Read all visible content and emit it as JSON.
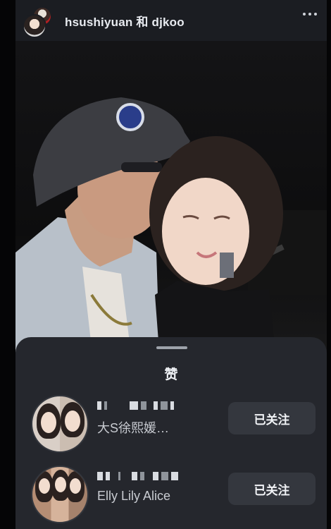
{
  "header": {
    "title": "hsushiyuan 和 djkoo",
    "more_icon": "more-horizontal-icon"
  },
  "photo": {
    "description_icon": "photo-image"
  },
  "likes_sheet": {
    "title": "赞",
    "users": [
      {
        "display_name": "大S徐熙媛…",
        "follow_label": "已关注"
      },
      {
        "display_name": "Elly Lily Alice",
        "follow_label": "已关注"
      }
    ]
  },
  "colors": {
    "background": "#0f1115",
    "sheet": "#25272d",
    "button": "#34373e",
    "text_primary": "#eef0f4",
    "text_secondary": "#c9ccd2"
  }
}
